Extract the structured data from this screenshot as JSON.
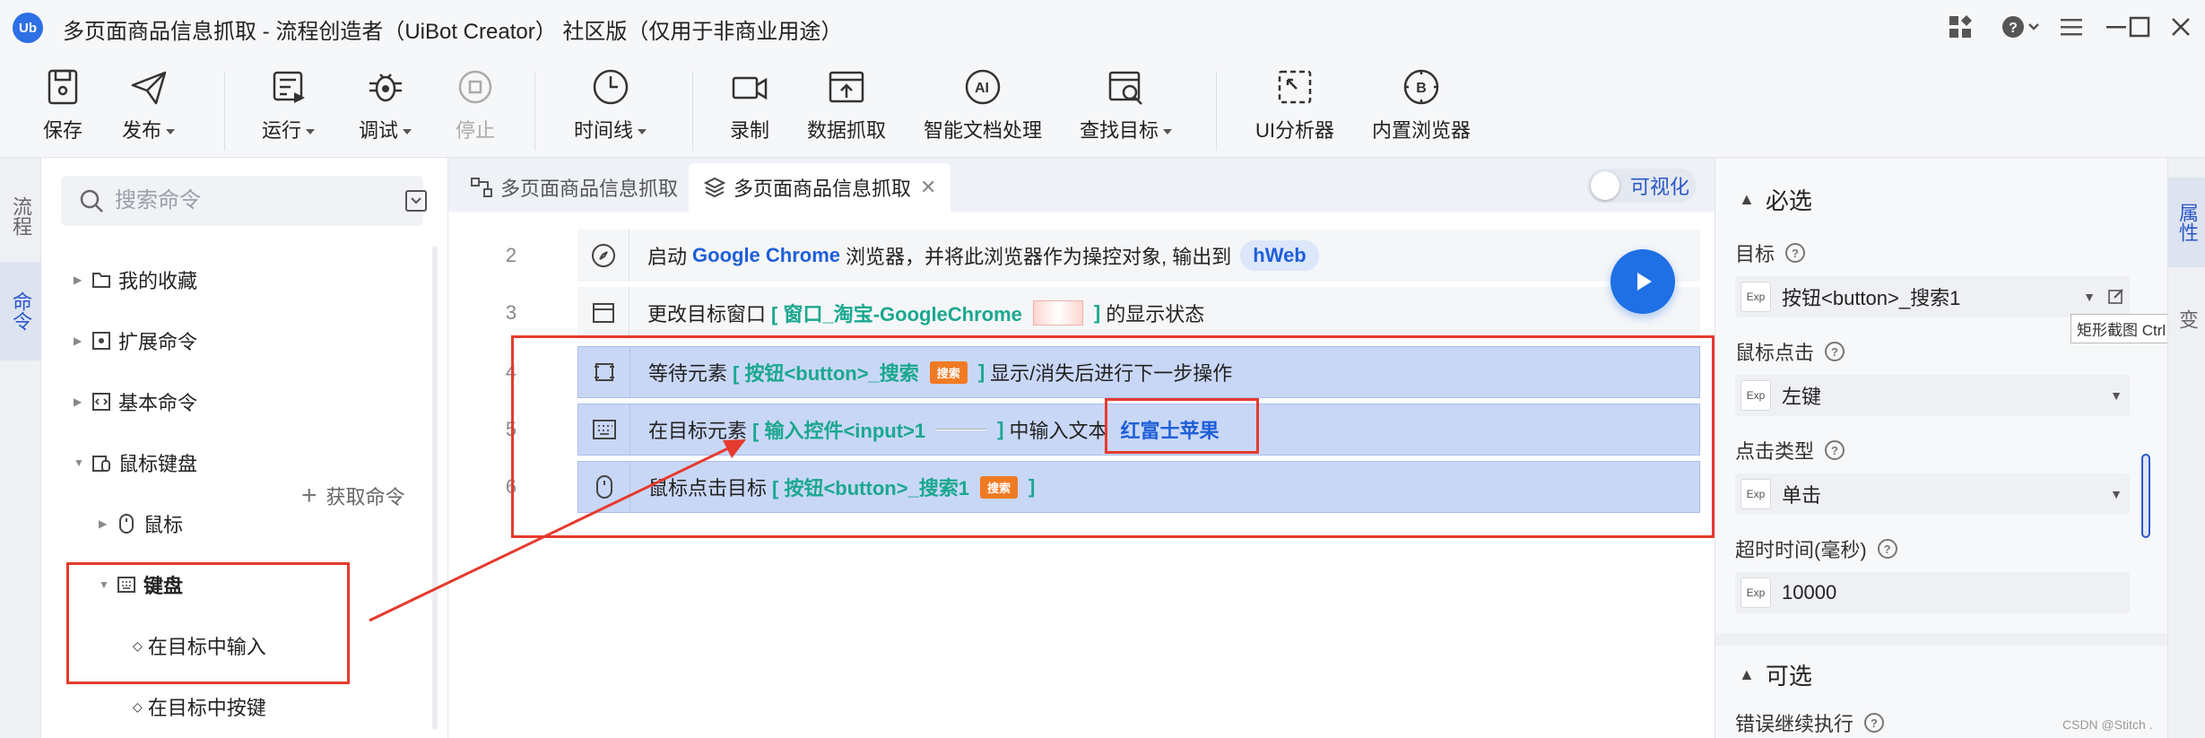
{
  "window": {
    "title": "多页面商品信息抓取 - 流程创造者（UiBot Creator） 社区版（仅用于非商业用途）",
    "logo_text": "Ub"
  },
  "toolbar": {
    "save": "保存",
    "publish": "发布",
    "run": "运行",
    "debug": "调试",
    "stop": "停止",
    "timeline": "时间线",
    "record": "录制",
    "data_scrape": "数据抓取",
    "smart_doc": "智能文档处理",
    "find_target": "查找目标",
    "ui_analyzer": "UI分析器",
    "builtin_browser": "内置浏览器"
  },
  "left_rail": {
    "flow": "流程",
    "commands": "命令"
  },
  "command_panel": {
    "search_placeholder": "搜索命令",
    "get_commands": "获取命令",
    "tree": {
      "favorites": "我的收藏",
      "extensions": "扩展命令",
      "basic": "基本命令",
      "mouse_keyboard": "鼠标键盘",
      "mouse": "鼠标",
      "keyboard": "键盘",
      "type_in_target": "在目标中输入",
      "press_in_target": "在目标中按键"
    }
  },
  "editor": {
    "tabs": [
      {
        "label": "多页面商品信息抓取"
      },
      {
        "label": "多页面商品信息抓取"
      }
    ],
    "visualize_label": "可视化",
    "rows": [
      {
        "num": "2",
        "t1": "启动",
        "kw": "Google Chrome",
        "t2": "浏览器，并将此浏览器作为操控对象, 输出到",
        "out": "hWeb"
      },
      {
        "num": "3",
        "t1": "更改目标窗口",
        "target": "[ 窗口_淘宝-GoogleChrome",
        "close": "]",
        "t2": "的显示状态"
      },
      {
        "num": "4",
        "t1": "等待元素",
        "target": "[ 按钮<button>_搜索",
        "chip": "搜索",
        "close": "]",
        "t2": "显示/消失后进行下一步操作"
      },
      {
        "num": "5",
        "t1": "在目标元素",
        "target": "[ 输入控件<input>1",
        "close": "]",
        "t2": "中输入文本",
        "value": "红富士苹果"
      },
      {
        "num": "6",
        "t1": "鼠标点击目标",
        "target": "[ 按钮<button>_搜索1",
        "chip": "搜索",
        "close": "]"
      }
    ]
  },
  "properties": {
    "required_title": "必选",
    "target_label": "目标",
    "target_value": "按钮<button>_搜索1",
    "mouse_click_label": "鼠标点击",
    "mouse_click_value": "左键",
    "click_type_label": "点击类型",
    "click_type_value": "单击",
    "timeout_label": "超时时间(毫秒)",
    "timeout_value": "10000",
    "optional_title": "可选",
    "error_continue_label": "错误继续执行",
    "exp_tag": "Exp",
    "tooltip": "矩形截图 Ctrl + Al"
  },
  "right_rail": {
    "attributes": "属性",
    "variables": "变"
  },
  "watermark": "CSDN @Stitch .",
  "colors": {
    "accent": "#2a57c9",
    "highlight": "#e53a2e",
    "keyword": "#1f5fd8",
    "target": "#1aa88f",
    "chip": "#f07a23"
  }
}
